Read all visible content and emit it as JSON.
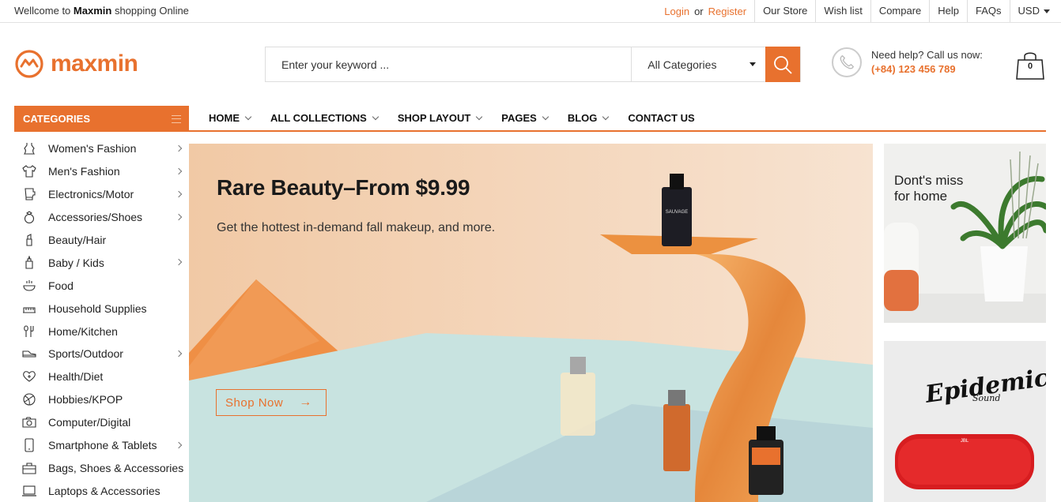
{
  "topbar": {
    "welcome_prefix": "Wellcome to",
    "welcome_brand": "Maxmin",
    "welcome_suffix": "shopping Online",
    "login": "Login",
    "or": "or",
    "register": "Register",
    "links": [
      "Our Store",
      "Wish list",
      "Compare",
      "Help",
      "FAQs"
    ],
    "currency": "USD"
  },
  "header": {
    "logo_text": "maxmin",
    "search_placeholder": "Enter your keyword ...",
    "category_select": "All Categories",
    "help_line1": "Need help? Call us now:",
    "help_phone": "(+84) 123 456 789",
    "cart_count": "0"
  },
  "nav": {
    "categories_label": "CATEGORIES",
    "items": [
      {
        "label": "HOME",
        "dropdown": true
      },
      {
        "label": "ALL COLLECTIONS",
        "dropdown": true
      },
      {
        "label": "SHOP LAYOUT",
        "dropdown": true
      },
      {
        "label": "PAGES",
        "dropdown": true
      },
      {
        "label": "BLOG",
        "dropdown": true
      },
      {
        "label": "CONTACT US",
        "dropdown": false
      }
    ]
  },
  "sidebar": {
    "items": [
      {
        "label": "Women's Fashion",
        "icon": "dress-icon",
        "submenu": true
      },
      {
        "label": "Men's Fashion",
        "icon": "shirt-icon",
        "submenu": true
      },
      {
        "label": "Electronics/Motor",
        "icon": "blender-icon",
        "submenu": true
      },
      {
        "label": "Accessories/Shoes",
        "icon": "ring-icon",
        "submenu": true
      },
      {
        "label": "Beauty/Hair",
        "icon": "lipstick-icon",
        "submenu": false
      },
      {
        "label": "Baby / Kids",
        "icon": "baby-bottle-icon",
        "submenu": true
      },
      {
        "label": "Food",
        "icon": "food-icon",
        "submenu": false
      },
      {
        "label": "Household Supplies",
        "icon": "household-icon",
        "submenu": false
      },
      {
        "label": "Home/Kitchen",
        "icon": "kitchen-icon",
        "submenu": false
      },
      {
        "label": "Sports/Outdoor",
        "icon": "shoe-icon",
        "submenu": true
      },
      {
        "label": "Health/Diet",
        "icon": "heart-icon",
        "submenu": false
      },
      {
        "label": "Hobbies/KPOP",
        "icon": "ball-icon",
        "submenu": false
      },
      {
        "label": "Computer/Digital",
        "icon": "camera-icon",
        "submenu": false
      },
      {
        "label": "Smartphone & Tablets",
        "icon": "smartphone-icon",
        "submenu": true
      },
      {
        "label": "Bags, Shoes & Accessories",
        "icon": "bag-icon",
        "submenu": false
      },
      {
        "label": "Laptops & Accessories",
        "icon": "laptop-icon",
        "submenu": false
      }
    ]
  },
  "banner": {
    "title": "Rare Beauty–From $9.99",
    "subtitle": "Get the hottest in-demand fall makeup, and more.",
    "cta": "Shop Now",
    "cta_arrow": "→",
    "bottle_label": "SAUVAGE"
  },
  "side_banners": {
    "top_line1": "Dont's miss",
    "top_line2": "for home",
    "bottom_brand": "Epidemic",
    "bottom_brand_sub": "Sound",
    "speaker_label": "JBL"
  },
  "colors": {
    "accent": "#e8712e",
    "text": "#222222"
  }
}
